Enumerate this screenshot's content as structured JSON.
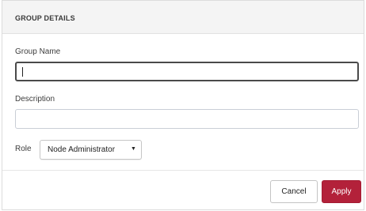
{
  "dialog": {
    "title": "GROUP DETAILS",
    "group_name": {
      "label": "Group Name",
      "value": ""
    },
    "description": {
      "label": "Description",
      "value": ""
    },
    "role": {
      "label": "Role",
      "selected": "Node Administrator"
    },
    "buttons": {
      "cancel": "Cancel",
      "apply": "Apply"
    }
  },
  "colors": {
    "header_bg": "#f4f4f4",
    "apply_bg": "#b3213a",
    "focused_border": "#4a4a4a",
    "input_border": "#c9ced6"
  }
}
